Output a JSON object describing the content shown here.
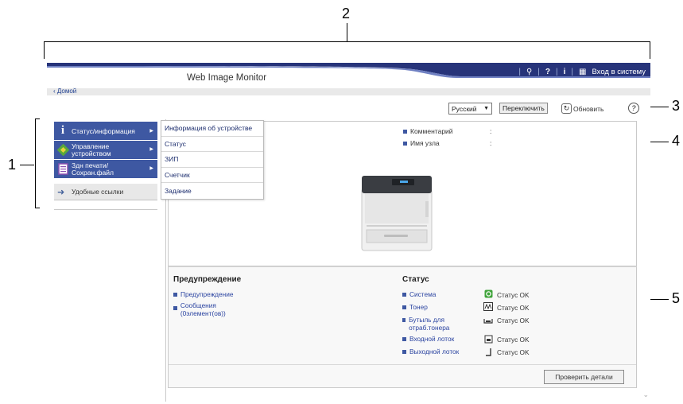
{
  "callouts": [
    "1",
    "2",
    "3",
    "4",
    "5"
  ],
  "header": {
    "app_title": "Web Image Monitor",
    "login_label": "Вход в систему"
  },
  "breadcrumb": {
    "home": "‹ Домой"
  },
  "toolbar": {
    "language_value": "Русский",
    "switch_label": "Переключить",
    "refresh_label": "Обновить",
    "help_label": "?"
  },
  "sidebar": {
    "items": [
      {
        "label": "Статус/информация",
        "icon": "info-icon"
      },
      {
        "label": "Управление устройством",
        "icon": "device-management-icon"
      },
      {
        "label": "Здн печати/Сохран.файл",
        "icon": "print-job-icon"
      }
    ],
    "quick_links": "Удобные ссылки"
  },
  "submenu": {
    "items": [
      "Информация об устройстве",
      "Статус",
      "ЗИП",
      "Счетчик",
      "Задание"
    ]
  },
  "device_info": {
    "comment_label": "Комментарий",
    "comment_value": ":",
    "host_label": "Имя узла",
    "host_value": ":"
  },
  "warnings": {
    "title": "Предупреждение",
    "items": [
      "Предупреждение",
      "Сообщения (0элемент(ов))"
    ]
  },
  "status": {
    "title": "Статус",
    "rows": [
      {
        "label": "Система",
        "value": "Статус OK",
        "icon": "system-ok-icon"
      },
      {
        "label": "Тонер",
        "value": "Статус OK",
        "icon": "toner-icon"
      },
      {
        "label": "Бутыль для отраб.тонера",
        "value": "Статус OK",
        "icon": "waste-toner-icon"
      },
      {
        "label": "Входной лоток",
        "value": "Статус OK",
        "icon": "input-tray-icon"
      },
      {
        "label": "Выходной лоток",
        "value": "Статус OK",
        "icon": "output-tray-icon"
      }
    ]
  },
  "actions": {
    "check_details": "Проверить детали"
  },
  "colors": {
    "accent": "#3e58a2",
    "header_band": "#27347a"
  }
}
